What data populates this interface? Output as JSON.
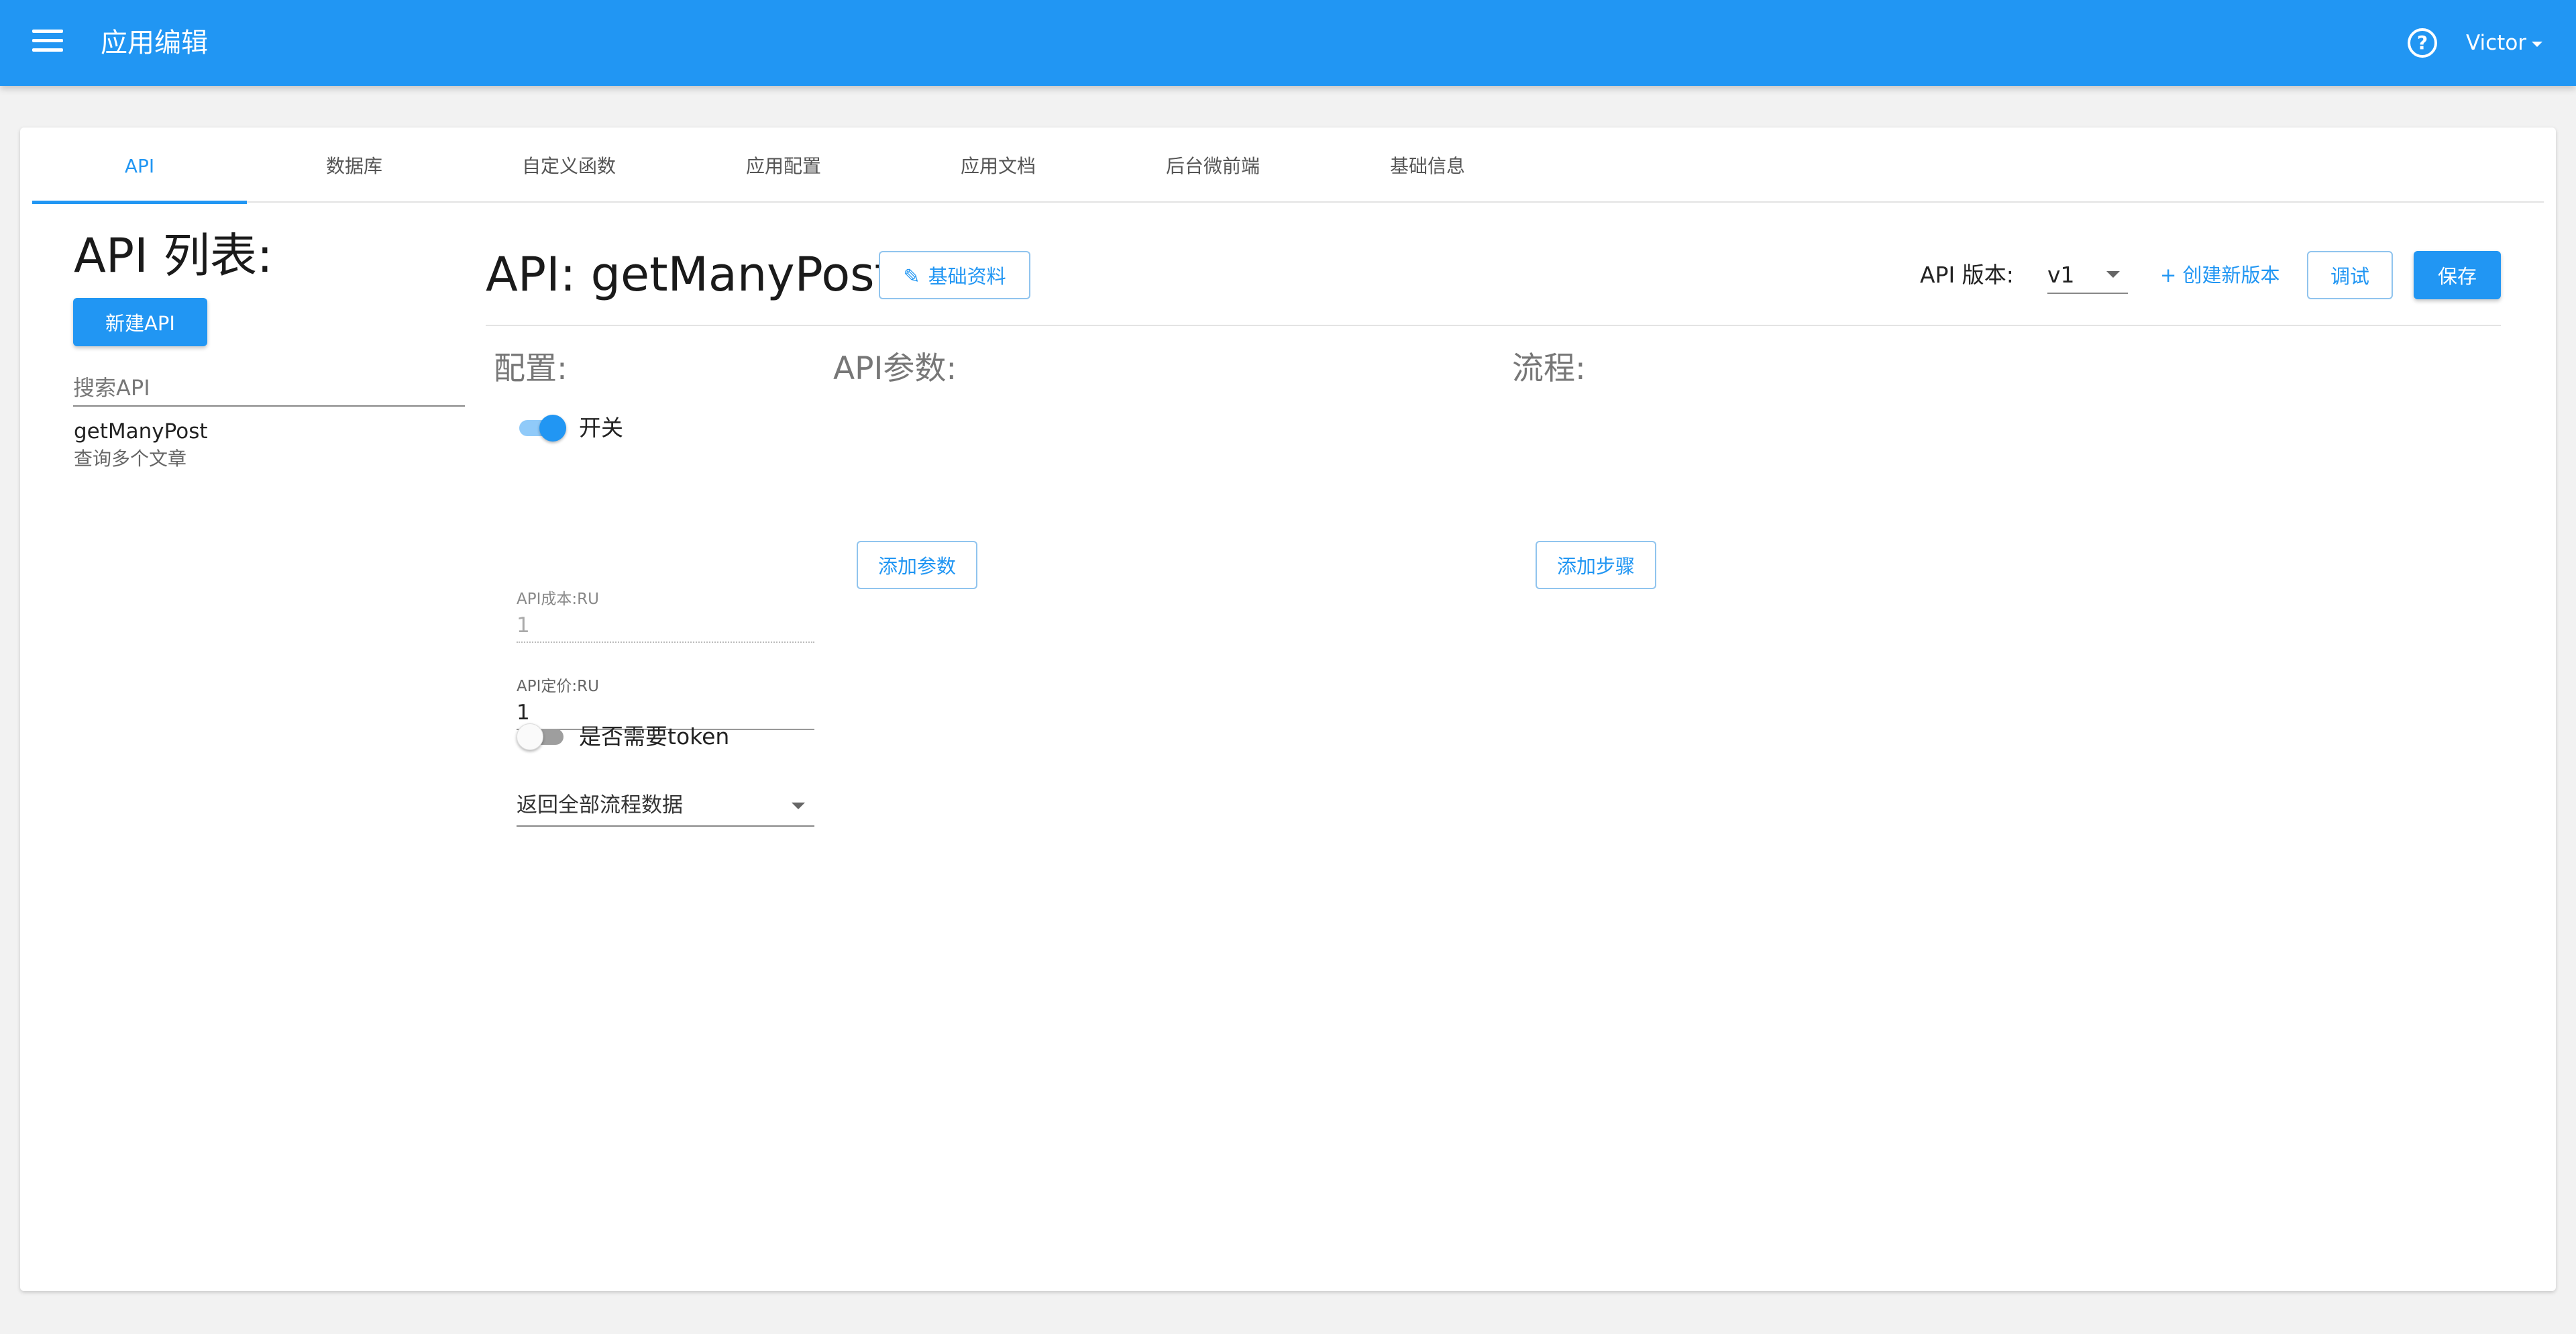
{
  "appbar": {
    "title": "应用编辑",
    "user": "Victor",
    "bg_color": "#2196f3",
    "icons": {
      "menu": "hamburger-menu-icon",
      "help": "help-circle-icon",
      "caret": "caret-down-icon"
    }
  },
  "tabs": [
    {
      "label": "API",
      "active": true
    },
    {
      "label": "数据库",
      "active": false
    },
    {
      "label": "自定义函数",
      "active": false
    },
    {
      "label": "应用配置",
      "active": false
    },
    {
      "label": "应用文档",
      "active": false
    },
    {
      "label": "后台微前端",
      "active": false
    },
    {
      "label": "基础信息",
      "active": false
    }
  ],
  "left": {
    "title": "API 列表:",
    "new_button": "新建API",
    "search_placeholder": "搜索API",
    "items": [
      {
        "name": "getManyPost",
        "desc": "查询多个文章"
      }
    ]
  },
  "header": {
    "api_title": "API: getManyPost",
    "basic_button": "基础资料",
    "version_label": "API 版本:",
    "version_value": "v1",
    "create_version": "+ 创建新版本",
    "debug_button": "调试",
    "save_button": "保存"
  },
  "config": {
    "title": "配置:",
    "switch_label": "开关",
    "switch_on": true,
    "cost_label": "API成本:RU",
    "cost_value": "1",
    "price_label": "API定价:RU",
    "price_value": "1",
    "return_select": "返回全部流程数据",
    "token_label": "是否需要token",
    "token_on": false
  },
  "params": {
    "title": "API参数:",
    "add_button": "添加参数"
  },
  "flow": {
    "title": "流程:",
    "add_button": "添加步骤"
  },
  "colors": {
    "accent": "#2196f3",
    "outline_border": "#90c4ee",
    "background": "#f2f2f2"
  }
}
